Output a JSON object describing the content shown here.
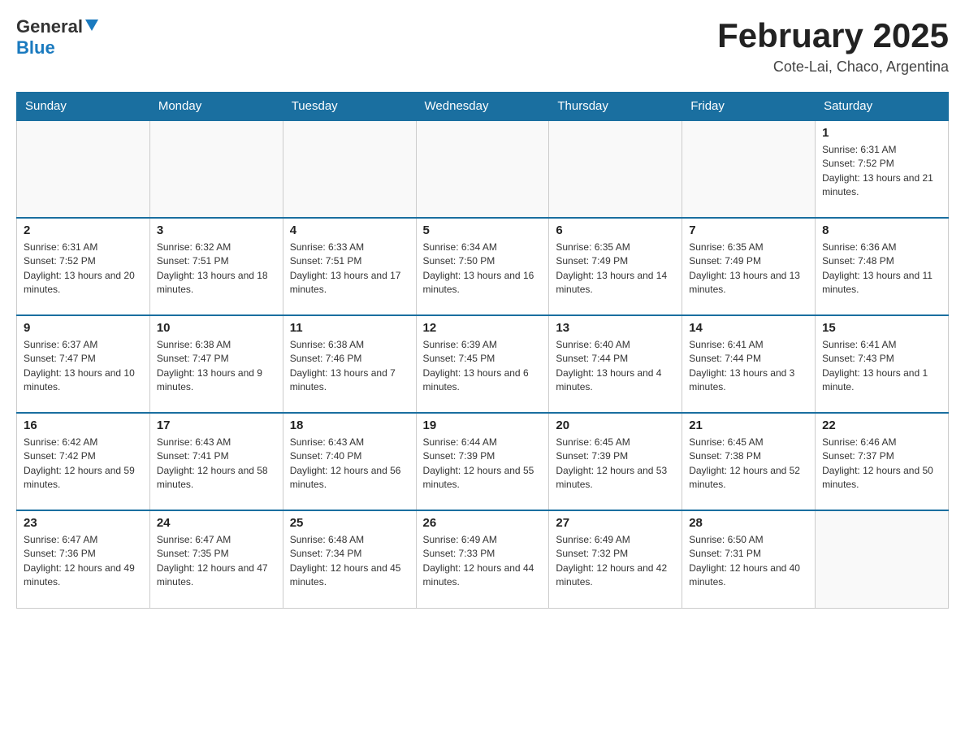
{
  "header": {
    "logo_general": "General",
    "logo_blue": "Blue",
    "month_title": "February 2025",
    "location": "Cote-Lai, Chaco, Argentina"
  },
  "days_of_week": [
    "Sunday",
    "Monday",
    "Tuesday",
    "Wednesday",
    "Thursday",
    "Friday",
    "Saturday"
  ],
  "weeks": [
    [
      {
        "day": "",
        "info": ""
      },
      {
        "day": "",
        "info": ""
      },
      {
        "day": "",
        "info": ""
      },
      {
        "day": "",
        "info": ""
      },
      {
        "day": "",
        "info": ""
      },
      {
        "day": "",
        "info": ""
      },
      {
        "day": "1",
        "info": "Sunrise: 6:31 AM\nSunset: 7:52 PM\nDaylight: 13 hours and 21 minutes."
      }
    ],
    [
      {
        "day": "2",
        "info": "Sunrise: 6:31 AM\nSunset: 7:52 PM\nDaylight: 13 hours and 20 minutes."
      },
      {
        "day": "3",
        "info": "Sunrise: 6:32 AM\nSunset: 7:51 PM\nDaylight: 13 hours and 18 minutes."
      },
      {
        "day": "4",
        "info": "Sunrise: 6:33 AM\nSunset: 7:51 PM\nDaylight: 13 hours and 17 minutes."
      },
      {
        "day": "5",
        "info": "Sunrise: 6:34 AM\nSunset: 7:50 PM\nDaylight: 13 hours and 16 minutes."
      },
      {
        "day": "6",
        "info": "Sunrise: 6:35 AM\nSunset: 7:49 PM\nDaylight: 13 hours and 14 minutes."
      },
      {
        "day": "7",
        "info": "Sunrise: 6:35 AM\nSunset: 7:49 PM\nDaylight: 13 hours and 13 minutes."
      },
      {
        "day": "8",
        "info": "Sunrise: 6:36 AM\nSunset: 7:48 PM\nDaylight: 13 hours and 11 minutes."
      }
    ],
    [
      {
        "day": "9",
        "info": "Sunrise: 6:37 AM\nSunset: 7:47 PM\nDaylight: 13 hours and 10 minutes."
      },
      {
        "day": "10",
        "info": "Sunrise: 6:38 AM\nSunset: 7:47 PM\nDaylight: 13 hours and 9 minutes."
      },
      {
        "day": "11",
        "info": "Sunrise: 6:38 AM\nSunset: 7:46 PM\nDaylight: 13 hours and 7 minutes."
      },
      {
        "day": "12",
        "info": "Sunrise: 6:39 AM\nSunset: 7:45 PM\nDaylight: 13 hours and 6 minutes."
      },
      {
        "day": "13",
        "info": "Sunrise: 6:40 AM\nSunset: 7:44 PM\nDaylight: 13 hours and 4 minutes."
      },
      {
        "day": "14",
        "info": "Sunrise: 6:41 AM\nSunset: 7:44 PM\nDaylight: 13 hours and 3 minutes."
      },
      {
        "day": "15",
        "info": "Sunrise: 6:41 AM\nSunset: 7:43 PM\nDaylight: 13 hours and 1 minute."
      }
    ],
    [
      {
        "day": "16",
        "info": "Sunrise: 6:42 AM\nSunset: 7:42 PM\nDaylight: 12 hours and 59 minutes."
      },
      {
        "day": "17",
        "info": "Sunrise: 6:43 AM\nSunset: 7:41 PM\nDaylight: 12 hours and 58 minutes."
      },
      {
        "day": "18",
        "info": "Sunrise: 6:43 AM\nSunset: 7:40 PM\nDaylight: 12 hours and 56 minutes."
      },
      {
        "day": "19",
        "info": "Sunrise: 6:44 AM\nSunset: 7:39 PM\nDaylight: 12 hours and 55 minutes."
      },
      {
        "day": "20",
        "info": "Sunrise: 6:45 AM\nSunset: 7:39 PM\nDaylight: 12 hours and 53 minutes."
      },
      {
        "day": "21",
        "info": "Sunrise: 6:45 AM\nSunset: 7:38 PM\nDaylight: 12 hours and 52 minutes."
      },
      {
        "day": "22",
        "info": "Sunrise: 6:46 AM\nSunset: 7:37 PM\nDaylight: 12 hours and 50 minutes."
      }
    ],
    [
      {
        "day": "23",
        "info": "Sunrise: 6:47 AM\nSunset: 7:36 PM\nDaylight: 12 hours and 49 minutes."
      },
      {
        "day": "24",
        "info": "Sunrise: 6:47 AM\nSunset: 7:35 PM\nDaylight: 12 hours and 47 minutes."
      },
      {
        "day": "25",
        "info": "Sunrise: 6:48 AM\nSunset: 7:34 PM\nDaylight: 12 hours and 45 minutes."
      },
      {
        "day": "26",
        "info": "Sunrise: 6:49 AM\nSunset: 7:33 PM\nDaylight: 12 hours and 44 minutes."
      },
      {
        "day": "27",
        "info": "Sunrise: 6:49 AM\nSunset: 7:32 PM\nDaylight: 12 hours and 42 minutes."
      },
      {
        "day": "28",
        "info": "Sunrise: 6:50 AM\nSunset: 7:31 PM\nDaylight: 12 hours and 40 minutes."
      },
      {
        "day": "",
        "info": ""
      }
    ]
  ]
}
